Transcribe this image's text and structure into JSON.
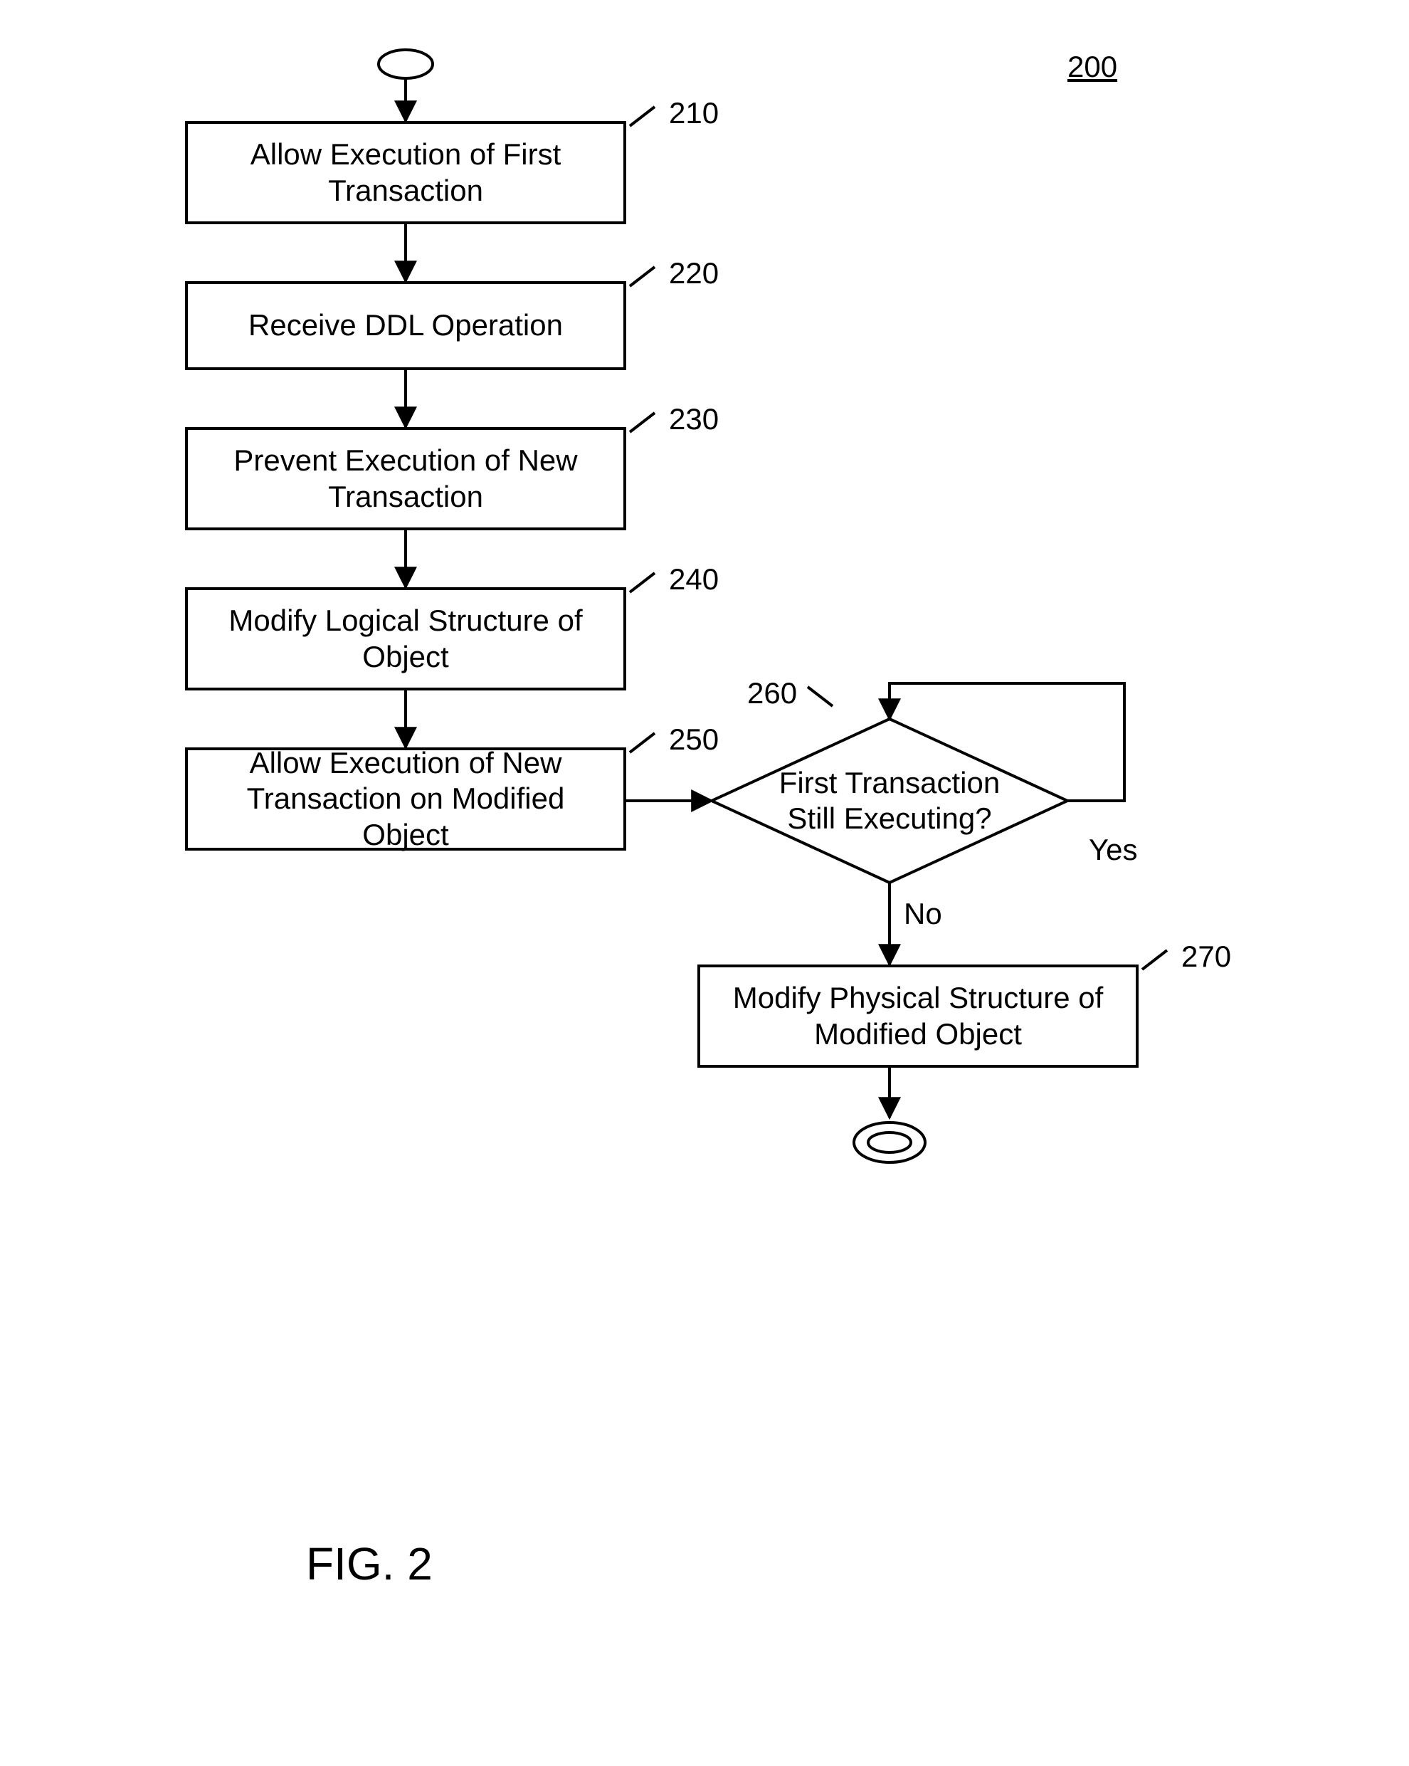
{
  "figure_ref": "200",
  "figure_label": "FIG. 2",
  "nodes": {
    "n210": {
      "ref": "210",
      "text": "Allow Execution of First\nTransaction"
    },
    "n220": {
      "ref": "220",
      "text": "Receive DDL Operation"
    },
    "n230": {
      "ref": "230",
      "text": "Prevent Execution of New\nTransaction"
    },
    "n240": {
      "ref": "240",
      "text": "Modify Logical Structure of\nObject"
    },
    "n250": {
      "ref": "250",
      "text": "Allow Execution of New\nTransaction on Modified Object"
    },
    "n260": {
      "ref": "260",
      "text": "First Transaction\nStill Executing?"
    },
    "n270": {
      "ref": "270",
      "text": "Modify Physical Structure of\nModified Object"
    }
  },
  "edges": {
    "yes": "Yes",
    "no": "No"
  }
}
